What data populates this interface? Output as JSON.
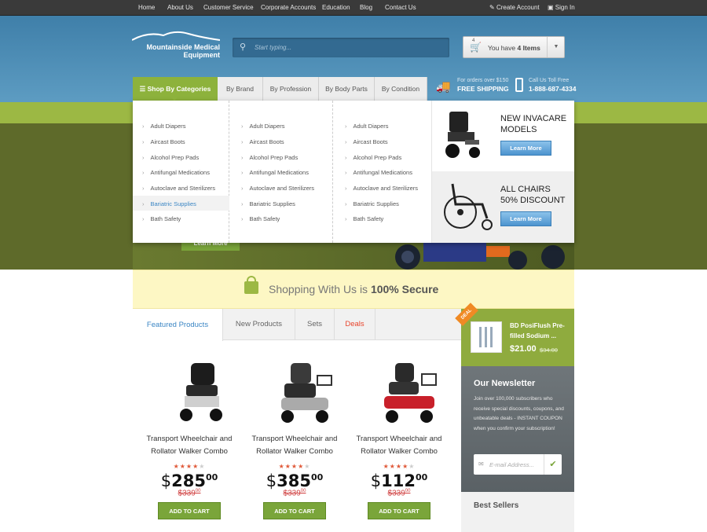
{
  "topnav": {
    "links": [
      "Home",
      "About Us",
      "Customer Service",
      "Corporate Accounts",
      "Education",
      "Blog",
      "Contact Us"
    ],
    "create_account": "Create Account",
    "sign_in": "Sign In"
  },
  "header": {
    "logo_line1": "Mountainside Medical",
    "logo_line2": "Equipment",
    "search_placeholder": "Start typing...",
    "cart_prefix": "You have ",
    "cart_count": "4 Items",
    "cart_badge": "4",
    "shipping_line1": "For orders over $150",
    "shipping_line2": "FREE SHIPPING",
    "phone_line1": "Call Us Toll Free",
    "phone_line2": "1-888-687-4334"
  },
  "menu": {
    "tabs": [
      "Shop By Categories",
      "By Brand",
      "By Profession",
      "By Body Parts",
      "By Condition"
    ],
    "columns": [
      [
        "Adult Diapers",
        "Aircast Boots",
        "Alcohol Prep Pads",
        "Antifungal Medications",
        "Autoclave and Sterilizers",
        "Bariatric Supplies",
        "Bath Safety"
      ],
      [
        "Adult Diapers",
        "Aircast Boots",
        "Alcohol Prep Pads",
        "Antifungal Medications",
        "Autoclave and Sterilizers",
        "Bariatric Supplies",
        "Bath Safety"
      ],
      [
        "Adult Diapers",
        "Aircast Boots",
        "Alcohol Prep Pads",
        "Antifungal Medications",
        "Autoclave and Sterilizers",
        "Bariatric Supplies",
        "Bath Safety"
      ]
    ],
    "promo1": {
      "line1": "NEW INVACARE",
      "line2": "MODELS",
      "button": "Learn More"
    },
    "promo2": {
      "line1": "ALL CHAIRS",
      "line2": "50% DISCOUNT",
      "button": "Learn More"
    }
  },
  "hero": {
    "button": "Learn More"
  },
  "secure": {
    "prefix": "Shopping With Us is ",
    "bold": "100% Secure"
  },
  "product_tabs": [
    "Featured Products",
    "New Products",
    "Sets",
    "Deals"
  ],
  "products": [
    {
      "name_line1": "Transport Wheelchair and",
      "name_line2": "Rollator Walker Combo",
      "price_dollar": "$",
      "price_int": "285",
      "price_cents": "00",
      "old_price": "$339",
      "old_cents": "00",
      "button": "ADD TO CART",
      "rating": 4
    },
    {
      "name_line1": "Transport Wheelchair and",
      "name_line2": "Rollator Walker Combo",
      "price_dollar": "$",
      "price_int": "385",
      "price_cents": "00",
      "old_price": "$339",
      "old_cents": "00",
      "button": "ADD TO CART",
      "rating": 4
    },
    {
      "name_line1": "Transport Wheelchair and",
      "name_line2": "Rollator Walker Combo",
      "price_dollar": "$",
      "price_int": "112",
      "price_cents": "00",
      "old_price": "$339",
      "old_cents": "00",
      "button": "ADD TO CART",
      "rating": 4
    }
  ],
  "deal": {
    "ribbon": "DEAL",
    "name_line1": "BD PosiFlush Pre-",
    "name_line2": "filled Sodium ...",
    "price": "$21.00",
    "old_price": "$34.00"
  },
  "newsletter": {
    "title": "Our Newsletter",
    "text": "Join over 100,000 subscribers who receive special discounts, coupons, and unbeatable deals - INSTANT COUPON when you confirm your subscription!",
    "placeholder": "E-mail Address..."
  },
  "best_sellers": {
    "title": "Best Sellers"
  },
  "colors": {
    "accent_green": "#9cb844",
    "header_blue": "#4a89b3",
    "deal_orange": "#f08a24",
    "deals_red": "#e8442c"
  }
}
